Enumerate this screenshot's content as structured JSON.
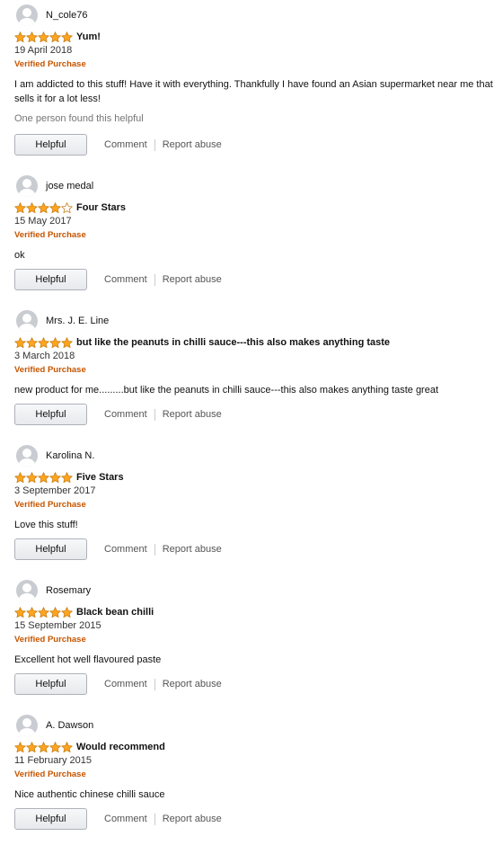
{
  "reviews": [
    {
      "author": "N_cole76",
      "stars": 5,
      "title": "Yum!",
      "date": "19 April 2018",
      "verified": "Verified Purchase",
      "body": "I am addicted to this stuff! Have it with everything. Thankfully I have found an Asian supermarket near me that sells it for a lot less!",
      "helpful_count": "One person found this helpful",
      "helpful_label": "Helpful",
      "comment_label": "Comment",
      "report_label": "Report abuse"
    },
    {
      "author": "jose medal",
      "stars": 4,
      "title": "Four Stars",
      "date": "15 May 2017",
      "verified": "Verified Purchase",
      "body": "ok",
      "helpful_label": "Helpful",
      "comment_label": "Comment",
      "report_label": "Report abuse"
    },
    {
      "author": "Mrs. J. E. Line",
      "stars": 5,
      "title": "but like the peanuts in chilli sauce---this also makes anything taste",
      "date": "3 March 2018",
      "verified": "Verified Purchase",
      "body": "new product for me.........but like the peanuts in chilli sauce---this also makes anything taste great",
      "helpful_label": "Helpful",
      "comment_label": "Comment",
      "report_label": "Report abuse"
    },
    {
      "author": "Karolina N.",
      "stars": 5,
      "title": "Five Stars",
      "date": "3 September 2017",
      "verified": "Verified Purchase",
      "body": "Love this stuff!",
      "helpful_label": "Helpful",
      "comment_label": "Comment",
      "report_label": "Report abuse"
    },
    {
      "author": "Rosemary",
      "stars": 5,
      "title": "Black bean chilli",
      "date": "15 September 2015",
      "verified": "Verified Purchase",
      "body": "Excellent hot well flavoured paste",
      "helpful_label": "Helpful",
      "comment_label": "Comment",
      "report_label": "Report abuse"
    },
    {
      "author": "A. Dawson",
      "stars": 5,
      "title": "Would recommend",
      "date": "11 February 2015",
      "verified": "Verified Purchase",
      "body": "Nice authentic chinese chilli sauce",
      "helpful_label": "Helpful",
      "comment_label": "Comment",
      "report_label": "Report abuse"
    }
  ],
  "colors": {
    "star_filled": "#ffa41c",
    "star_outline": "#c7801a",
    "star_empty": "#ffffff",
    "verified": "#c45500",
    "link": "#555555"
  }
}
